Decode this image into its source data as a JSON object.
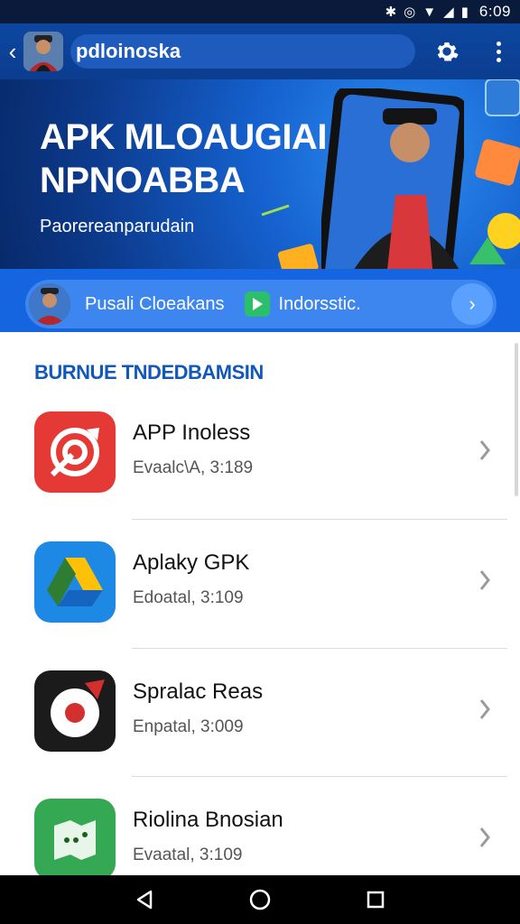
{
  "status_bar": {
    "time": "6:09"
  },
  "app_bar": {
    "title": "pdloinoska"
  },
  "banner": {
    "title_line1": "APK MLOAUGIAI",
    "title_line2": "NPNOABBA",
    "subtitle": "Paorereanparudain"
  },
  "promo": {
    "label1": "Pusali Cloeakans",
    "label2": "Indorsstic."
  },
  "section": {
    "title": "BURNUE TNDEDBAMSIN"
  },
  "apps": [
    {
      "name": "APP Inoless",
      "sub": "Evaalc\\A, 3:189",
      "icon": "target-app-icon"
    },
    {
      "name": "Aplaky GPK",
      "sub": "Edoatal, 3:109",
      "icon": "drive-app-icon"
    },
    {
      "name": "Spralac Reas",
      "sub": "Enpatal, 3:009",
      "icon": "record-app-icon"
    },
    {
      "name": "Riolina Bnosian",
      "sub": "Evaatal, 3:109",
      "icon": "map-app-icon"
    }
  ],
  "colors": {
    "app_bar": "#0d47a1",
    "accent_blue": "#1565e0",
    "section_title": "#1258b8"
  }
}
